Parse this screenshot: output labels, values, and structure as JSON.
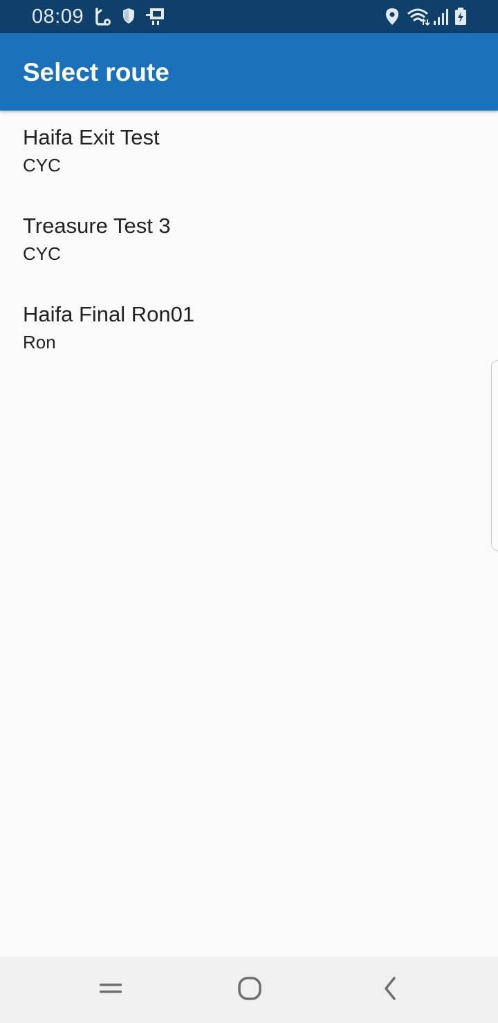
{
  "status_bar": {
    "time": "08:09",
    "left_icons": [
      "usb-debug-icon",
      "shield-icon",
      "cast-icon"
    ],
    "right_icons": [
      "location-icon",
      "wifi-icon",
      "signal-icon",
      "battery-charging-icon"
    ]
  },
  "app_bar": {
    "title": "Select route",
    "color": "#1b70ba"
  },
  "routes": [
    {
      "name": "Haifa Exit Test",
      "owner": "CYC"
    },
    {
      "name": "Treasure Test 3",
      "owner": "CYC"
    },
    {
      "name": "Haifa Final Ron01",
      "owner": "Ron"
    }
  ],
  "nav_bar": {
    "buttons": [
      "recents-icon",
      "home-icon",
      "back-icon"
    ]
  },
  "colors": {
    "status_bar": "#0f3f6b",
    "background": "#fafafa",
    "nav_bar": "#f0f0f0"
  }
}
